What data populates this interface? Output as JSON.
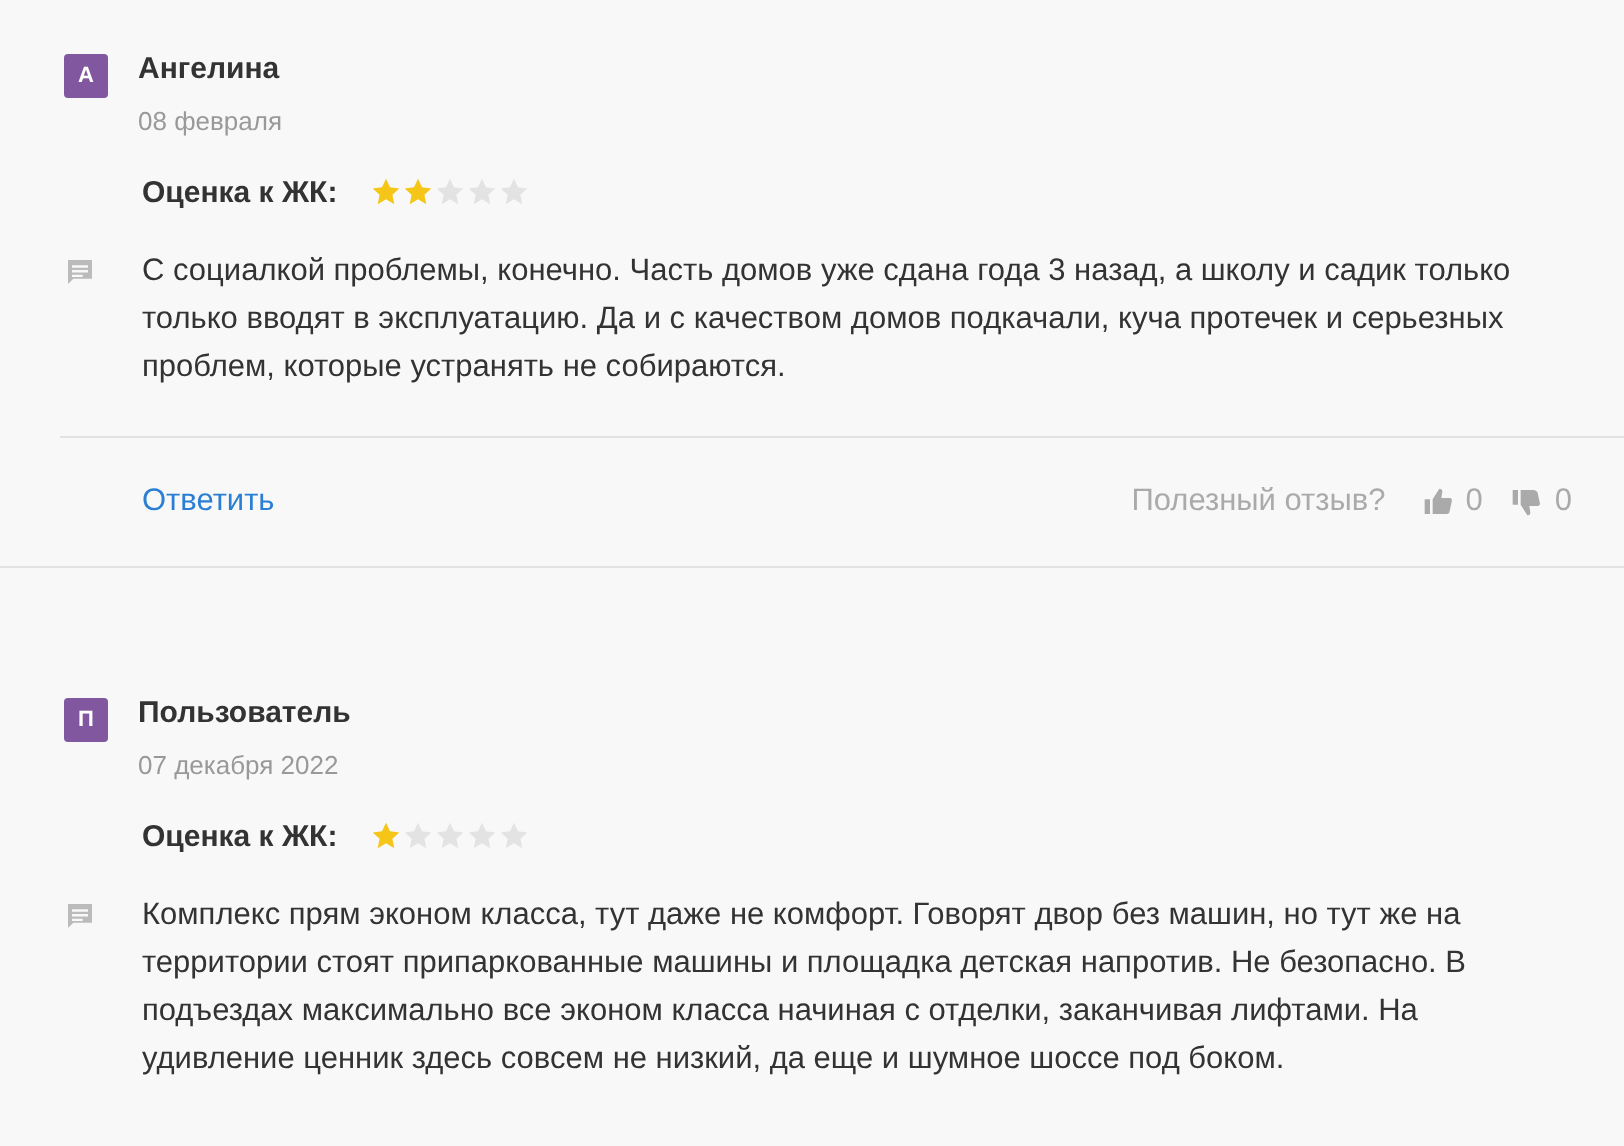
{
  "reviews": [
    {
      "initial": "А",
      "author": "Ангелина",
      "date": "08 февраля",
      "rating_label": "Оценка к ЖК:",
      "stars": 2,
      "text": "С социалкой проблемы, конечно. Часть домов уже сдана года 3 назад, а школу и садик только только вводят в эксплуатацию. Да и с качеством домов подкачали, куча протечек и серьезных проблем, которые устранять не собираются.",
      "reply": "Ответить",
      "helpful_label": "Полезный отзыв?",
      "likes": "0",
      "dislikes": "0"
    },
    {
      "initial": "П",
      "author": "Пользователь",
      "date": "07 декабря 2022",
      "rating_label": "Оценка к ЖК:",
      "stars": 1,
      "text": "Комплекс прям эконом класса, тут даже не комфорт. Говорят двор без машин, но тут же на территории стоят припаркованные машины и площадка детская напротив. Не безопасно. В подъездах максимально все эконом класса начиная с отделки, заканчивая лифтами. На удивление ценник здесь совсем не низкий, да еще и шумное шоссе под боком."
    }
  ]
}
